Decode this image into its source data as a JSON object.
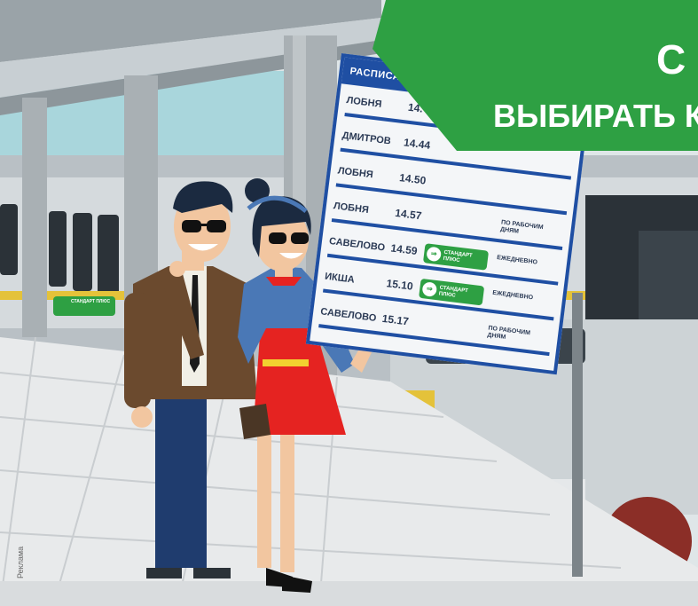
{
  "banner": {
    "line1": "С",
    "line2": "ВЫБИРАТЬ К",
    "color": "#2ea043"
  },
  "board": {
    "header": "РАСПИСАНИЕ Д",
    "rows": [
      {
        "station": "ЛОБНЯ",
        "time": "14.",
        "note": "",
        "badge": ""
      },
      {
        "station": "ДМИТРОВ",
        "time": "14.44",
        "note": "",
        "badge": ""
      },
      {
        "station": "ЛОБНЯ",
        "time": "14.50",
        "note": "",
        "badge": ""
      },
      {
        "station": "ЛОБНЯ",
        "time": "14.57",
        "note": "ПО РАБОЧИМ ДНЯМ",
        "badge": ""
      },
      {
        "station": "САВЕЛОВО",
        "time": "14.59",
        "note": "ЕЖЕДНЕВНО",
        "badge": "СТАНДАРТ ПЛЮС"
      },
      {
        "station": "ИКША",
        "time": "15.10",
        "note": "ЕЖЕДНЕВНО",
        "badge": "СТАНДАРТ ПЛЮС"
      },
      {
        "station": "САВЕЛОВО",
        "time": "15.17",
        "note": "ПО РАБОЧИМ ДНЯМ",
        "badge": ""
      }
    ]
  },
  "train_badge": "СТАНДАРТ ПЛЮС",
  "footer": {
    "reklama": "Реклама"
  }
}
